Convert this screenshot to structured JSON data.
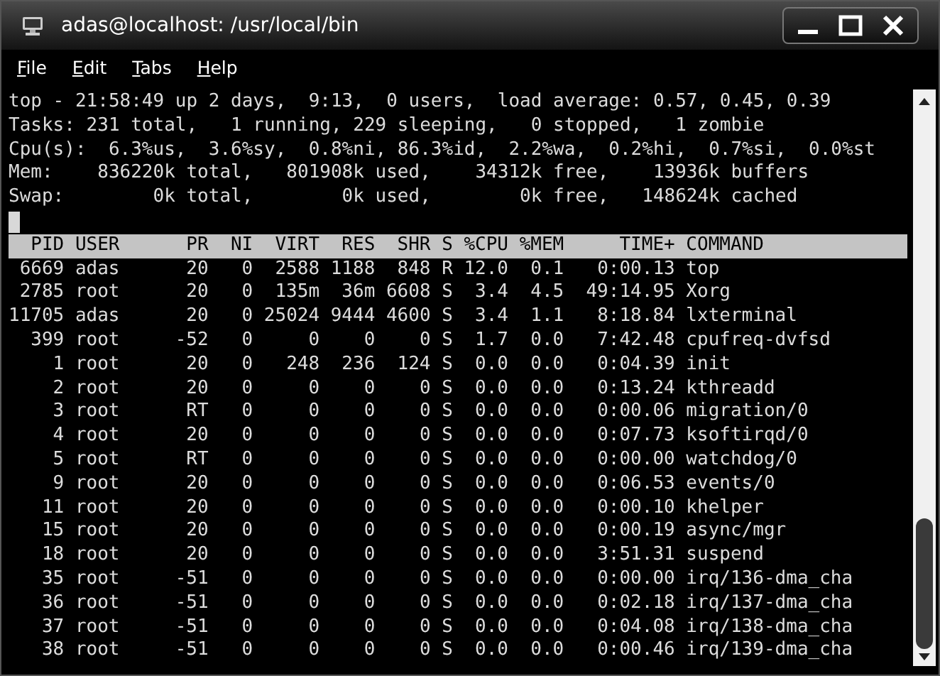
{
  "window": {
    "title": "adas@localhost: /usr/local/bin"
  },
  "menu": [
    {
      "label": "File"
    },
    {
      "label": "Edit"
    },
    {
      "label": "Tabs"
    },
    {
      "label": "Help"
    }
  ],
  "summary_lines": [
    "top - 21:58:49 up 2 days,  9:13,  0 users,  load average: 0.57, 0.45, 0.39",
    "Tasks: 231 total,   1 running, 229 sleeping,   0 stopped,   1 zombie",
    "Cpu(s):  6.3%us,  3.6%sy,  0.8%ni, 86.3%id,  2.2%wa,  0.2%hi,  0.7%si,  0.0%st",
    "Mem:    836220k total,   801908k used,    34312k free,    13936k buffers",
    "Swap:        0k total,        0k used,        0k free,   148624k cached"
  ],
  "table": {
    "columns": [
      "PID",
      "USER",
      "PR",
      "NI",
      "VIRT",
      "RES",
      "SHR",
      "S",
      "%CPU",
      "%MEM",
      "TIME+",
      "COMMAND"
    ],
    "rows": [
      [
        "6669",
        "adas",
        "20",
        "0",
        "2588",
        "1188",
        "848",
        "R",
        "12.0",
        "0.1",
        "0:00.13",
        "top"
      ],
      [
        "2785",
        "root",
        "20",
        "0",
        "135m",
        "36m",
        "6608",
        "S",
        "3.4",
        "4.5",
        "49:14.95",
        "Xorg"
      ],
      [
        "11705",
        "adas",
        "20",
        "0",
        "25024",
        "9444",
        "4600",
        "S",
        "3.4",
        "1.1",
        "8:18.84",
        "lxterminal"
      ],
      [
        "399",
        "root",
        "-52",
        "0",
        "0",
        "0",
        "0",
        "S",
        "1.7",
        "0.0",
        "7:42.48",
        "cpufreq-dvfsd"
      ],
      [
        "1",
        "root",
        "20",
        "0",
        "248",
        "236",
        "124",
        "S",
        "0.0",
        "0.0",
        "0:04.39",
        "init"
      ],
      [
        "2",
        "root",
        "20",
        "0",
        "0",
        "0",
        "0",
        "S",
        "0.0",
        "0.0",
        "0:13.24",
        "kthreadd"
      ],
      [
        "3",
        "root",
        "RT",
        "0",
        "0",
        "0",
        "0",
        "S",
        "0.0",
        "0.0",
        "0:00.06",
        "migration/0"
      ],
      [
        "4",
        "root",
        "20",
        "0",
        "0",
        "0",
        "0",
        "S",
        "0.0",
        "0.0",
        "0:07.73",
        "ksoftirqd/0"
      ],
      [
        "5",
        "root",
        "RT",
        "0",
        "0",
        "0",
        "0",
        "S",
        "0.0",
        "0.0",
        "0:00.00",
        "watchdog/0"
      ],
      [
        "9",
        "root",
        "20",
        "0",
        "0",
        "0",
        "0",
        "S",
        "0.0",
        "0.0",
        "0:06.53",
        "events/0"
      ],
      [
        "11",
        "root",
        "20",
        "0",
        "0",
        "0",
        "0",
        "S",
        "0.0",
        "0.0",
        "0:00.10",
        "khelper"
      ],
      [
        "15",
        "root",
        "20",
        "0",
        "0",
        "0",
        "0",
        "S",
        "0.0",
        "0.0",
        "0:00.19",
        "async/mgr"
      ],
      [
        "18",
        "root",
        "20",
        "0",
        "0",
        "0",
        "0",
        "S",
        "0.0",
        "0.0",
        "3:51.31",
        "suspend"
      ],
      [
        "35",
        "root",
        "-51",
        "0",
        "0",
        "0",
        "0",
        "S",
        "0.0",
        "0.0",
        "0:00.00",
        "irq/136-dma_cha"
      ],
      [
        "36",
        "root",
        "-51",
        "0",
        "0",
        "0",
        "0",
        "S",
        "0.0",
        "0.0",
        "0:02.18",
        "irq/137-dma_cha"
      ],
      [
        "37",
        "root",
        "-51",
        "0",
        "0",
        "0",
        "0",
        "S",
        "0.0",
        "0.0",
        "0:04.08",
        "irq/138-dma_cha"
      ],
      [
        "38",
        "root",
        "-51",
        "0",
        "0",
        "0",
        "0",
        "S",
        "0.0",
        "0.0",
        "0:00.46",
        "irq/139-dma_cha"
      ]
    ]
  }
}
